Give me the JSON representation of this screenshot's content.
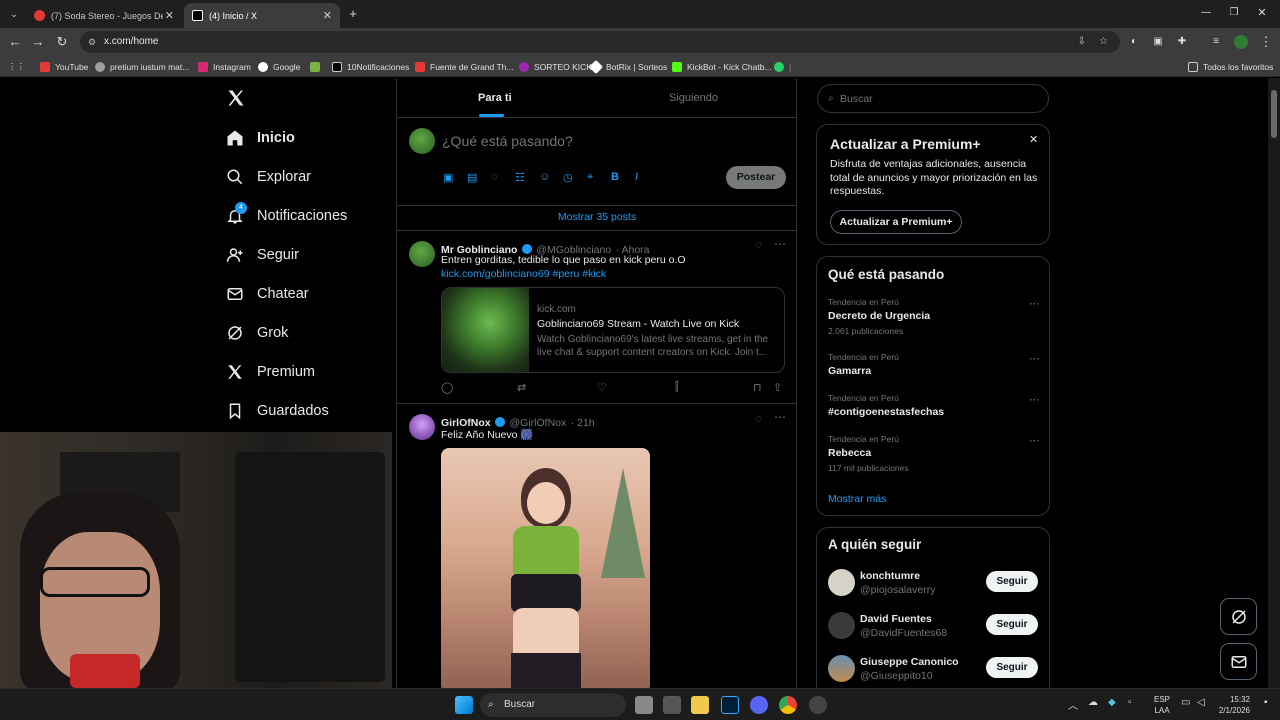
{
  "browser": {
    "tabs": [
      {
        "title": "(7) Soda Stereo - Juegos De Se...",
        "active": false
      },
      {
        "title": "(4) Inicio / X",
        "active": true
      }
    ],
    "new_tab": "+",
    "url": "x.com/home",
    "bookmarks": [
      "YouTube",
      "pretium iustum mat...",
      "Instagram",
      "Google",
      "10Notificaciones",
      "Fuente de Grand Th...",
      "SORTEO KICK",
      "BotRix | Sorteos",
      "KickBot - Kick Chatb..."
    ],
    "all_bookmarks": "Todos los favoritos"
  },
  "sidebar": {
    "items": [
      {
        "label": "Inicio",
        "icon": "home-icon"
      },
      {
        "label": "Explorar",
        "icon": "search-icon"
      },
      {
        "label": "Notificaciones",
        "icon": "bell-icon",
        "badge": "4"
      },
      {
        "label": "Seguir",
        "icon": "person-plus-icon"
      },
      {
        "label": "Chatear",
        "icon": "mail-icon"
      },
      {
        "label": "Grok",
        "icon": "grok-icon"
      },
      {
        "label": "Premium",
        "icon": "x-logo-icon"
      },
      {
        "label": "Guardados",
        "icon": "bookmark-icon"
      }
    ]
  },
  "feed": {
    "tabs": [
      "Para ti",
      "Siguiendo"
    ],
    "compose_placeholder": "¿Qué está pasando?",
    "post_button": "Postear",
    "show_more": "Mostrar 35 posts",
    "posts": [
      {
        "name": "Mr Goblinciano",
        "handle": "@MGoblinciano",
        "time": "· Ahora",
        "text": "Entren gorditas, tedible lo que paso en kick peru o.O",
        "link_text": "kick.com/goblinciano69 #peru #kick",
        "card": {
          "domain": "kick.com",
          "title": "Goblinciano69 Stream - Watch Live on Kick",
          "desc": "Watch Goblinciano69's latest live streams, get in the live chat & support content creators on Kick. Join t..."
        }
      },
      {
        "name": "GirlOfNox",
        "handle": "@GirlOfNox",
        "time": "· 21h",
        "text": "Feliz Año Nuevo 🎆"
      }
    ]
  },
  "right": {
    "search_placeholder": "Buscar",
    "premium": {
      "title": "Actualizar a Premium+",
      "desc": "Disfruta de ventajas adicionales, ausencia total de anuncios y mayor priorización en las respuestas.",
      "button": "Actualizar a Premium+"
    },
    "trends": {
      "title": "Qué está pasando",
      "items": [
        {
          "meta": "Tendencia en Perú",
          "title": "Decreto de Urgencia",
          "count": "2,061 publicaciones"
        },
        {
          "meta": "Tendencia en Perú",
          "title": "Gamarra",
          "count": ""
        },
        {
          "meta": "Tendencia en Perú",
          "title": "#contigoenestasfechas",
          "count": ""
        },
        {
          "meta": "Tendencia en Perú",
          "title": "Rebecca",
          "count": "117 mil publicaciones"
        }
      ],
      "more": "Mostrar más"
    },
    "who_to_follow": {
      "title": "A quién seguir",
      "users": [
        {
          "name": "konchtumre",
          "handle": "@piojosalaverry",
          "button": "Seguir"
        },
        {
          "name": "David Fuentes",
          "handle": "@DavidFuentes68",
          "button": "Seguir"
        },
        {
          "name": "Giuseppe Canonico",
          "handle": "@Giuseppito10",
          "button": "Seguir"
        }
      ]
    }
  },
  "taskbar": {
    "search": "Buscar",
    "lang": "ESP",
    "lang2": "LAA",
    "time": "15:32",
    "date": "2/1/2026"
  },
  "colors": {
    "accent": "#1d9bf0",
    "background": "#000000",
    "border": "#2f3336"
  }
}
